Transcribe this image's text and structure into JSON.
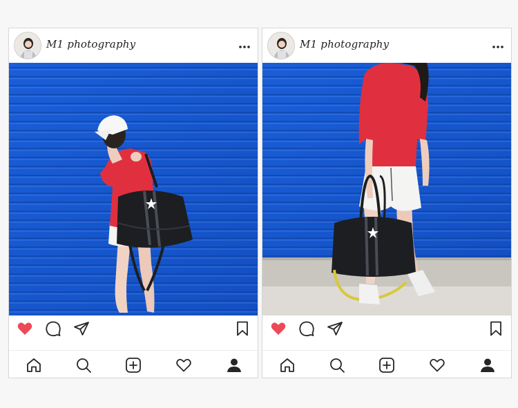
{
  "posts": [
    {
      "username": "M1 photography",
      "liked": true,
      "icons": {
        "avatar": "avatar",
        "more": "more-dots-icon",
        "like": "heart-filled-icon",
        "comment": "comment-icon",
        "share": "send-icon",
        "save": "bookmark-icon"
      },
      "photo": "woman-with-black-star-bag-blue-shutter"
    },
    {
      "username": "M1 photography",
      "liked": true,
      "icons": {
        "avatar": "avatar",
        "more": "more-dots-icon",
        "like": "heart-filled-icon",
        "comment": "comment-icon",
        "share": "send-icon",
        "save": "bookmark-icon"
      },
      "photo": "woman-standing-with-black-star-bag-blue-shutter"
    }
  ],
  "tabbar": [
    "home-icon",
    "search-icon",
    "add-post-icon",
    "activity-heart-icon",
    "profile-icon"
  ],
  "colors": {
    "like_red": "#ed4956",
    "shutter_blue": "#1857d2",
    "shirt_red": "#e0303f",
    "bag_black": "#1c1e22"
  }
}
